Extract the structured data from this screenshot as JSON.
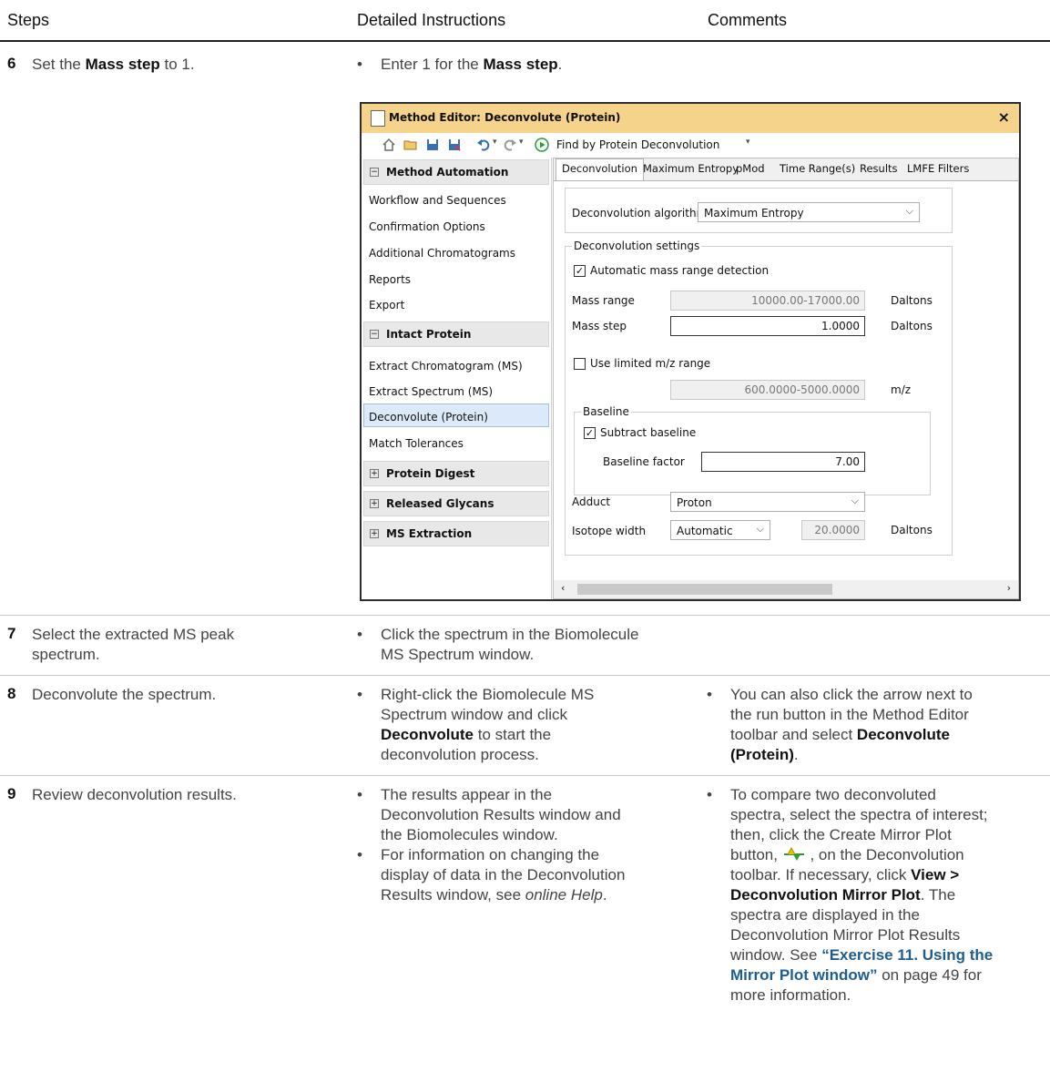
{
  "header": {
    "steps": "Steps",
    "detailed": "Detailed Instructions",
    "comments": "Comments"
  },
  "step6": {
    "num": "6",
    "text_pre": "Set the ",
    "text_bold": "Mass step",
    "text_post": " to 1.",
    "instr_pre": "Enter 1 for the ",
    "instr_bold": "Mass step",
    "instr_post": "."
  },
  "window": {
    "title": "Method Editor: Deconvolute (Protein)",
    "close": "×",
    "run_label": "Find by Protein Deconvolution",
    "left": {
      "groups": [
        "Method Automation",
        "Intact Protein",
        "Protein Digest",
        "Released Glycans",
        "MS Extraction"
      ],
      "automation_items": [
        "Workflow and Sequences",
        "Confirmation Options",
        "Additional Chromatograms",
        "Reports",
        "Export"
      ],
      "intact_items": [
        "Extract Chromatogram (MS)",
        "Extract Spectrum (MS)",
        "Deconvolute (Protein)",
        "Match Tolerances"
      ]
    },
    "tabs": [
      "Deconvolution",
      "Maximum Entropy",
      "pMod",
      "Time Range(s)",
      "Results",
      "LMFE Filters"
    ],
    "algo_label": "Deconvolution algorithm",
    "algo_value": "Maximum Entropy",
    "settings_label": "Deconvolution settings",
    "auto_mass": "Automatic mass range detection",
    "mass_range_label": "Mass range",
    "mass_range_value": "10000.00-17000.00",
    "daltons": "Daltons",
    "mass_step_label": "Mass step",
    "mass_step_value": "1.0000",
    "use_mz": "Use limited m/z range",
    "mz_value": "600.0000-5000.0000",
    "mz_unit": "m/z",
    "baseline_label": "Baseline",
    "subtract_baseline": "Subtract baseline",
    "baseline_factor_label": "Baseline factor",
    "baseline_factor_value": "7.00",
    "adduct_label": "Adduct",
    "adduct_value": "Proton",
    "isotope_label": "Isotope width",
    "isotope_value": "Automatic",
    "isotope_num": "20.0000"
  },
  "step7": {
    "num": "7",
    "text": [
      "Select the extracted MS peak",
      "spectrum."
    ],
    "instr": [
      "Click the spectrum in the Biomolecule",
      "MS Spectrum window."
    ]
  },
  "step8": {
    "num": "8",
    "text": "Deconvolute the spectrum.",
    "instr": [
      "Right-click the Biomolecule MS",
      "Spectrum window and click"
    ],
    "instr_bold": "Deconvolute",
    "instr_rest": " to start the",
    "instr_last": "deconvolution process.",
    "comment": [
      "You can also click the arrow next to",
      "the run button in the Method Editor",
      "toolbar and select "
    ],
    "comment_bold1": "Deconvolute",
    "comment_bold2": "(Protein)",
    "comment_end": "."
  },
  "step9": {
    "num": "9",
    "text": "Review deconvolution results.",
    "instr1": [
      "The results appear in the",
      "Deconvolution Results window and",
      "the Biomolecules window."
    ],
    "instr2": [
      "For information on changing the",
      "display of data in the Deconvolution",
      "Results window, see "
    ],
    "instr2_italic": "online Help",
    "instr2_end": ".",
    "comment": {
      "l1": "To compare two deconvoluted",
      "l2": "spectra, select the spectra of interest;",
      "l3": "then, click the Create Mirror Plot",
      "l4a": "button,",
      "l4b": ", on the Deconvolution",
      "l5a": "toolbar. If necessary, click ",
      "l5b": "View >",
      "l6a": "Deconvolution Mirror Plot",
      "l6b": ". The",
      "l7": "spectra are displayed in the",
      "l8": "Deconvolution Mirror Plot Results",
      "l9a": "window. See ",
      "l9b": "“Exercise 11. Using the",
      "l10a": "Mirror Plot window”",
      "l10b": " on page 49 for",
      "l11": "more information."
    }
  },
  "bullet": "•",
  "colors": {
    "link": "#1f5d8f",
    "titlebar": "#f5d38a",
    "mirror_icon": "#e6c200"
  }
}
